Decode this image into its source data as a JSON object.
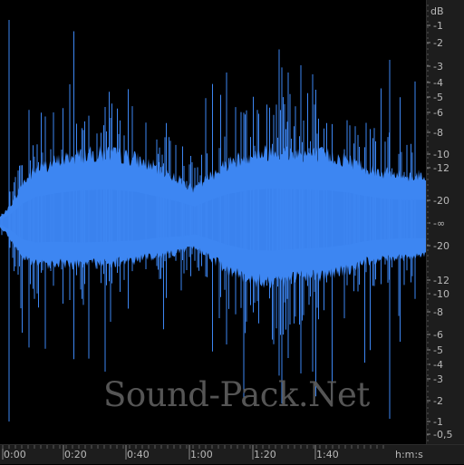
{
  "db_ruler": {
    "unit_label": "dB",
    "upper_labels": [
      "-1",
      "-2",
      "-3",
      "-4",
      "-5",
      "-6",
      "-8",
      "-10",
      "-12",
      "-20"
    ],
    "center_label": "-∞",
    "lower_labels": [
      "-20",
      "-12",
      "-10",
      "-8",
      "-6",
      "-5",
      "-4",
      "-3",
      "-2",
      "-1",
      "-0,5"
    ]
  },
  "time_ruler": {
    "labels": [
      "0:00",
      "0:20",
      "0:40",
      "1:00",
      "1:20",
      "1:40"
    ],
    "unit_label": "h:m:s"
  },
  "watermark": {
    "text": "Sound-Pack.Net"
  },
  "colors": {
    "waveform": "#3d86f2",
    "waveform_dark": "#2e6fd6",
    "ruler_bg": "#1d1d1d",
    "ruler_text": "#b8b8b8",
    "background": "#000000"
  }
}
